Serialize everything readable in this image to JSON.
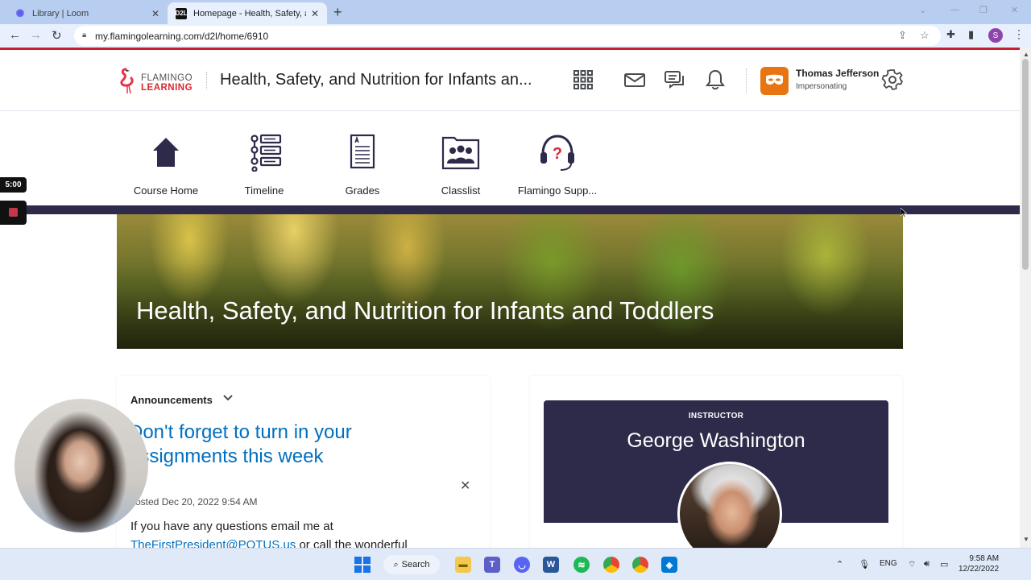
{
  "browser": {
    "tabs": [
      {
        "title": "Library | Loom",
        "active": false,
        "favicon": "loom-icon"
      },
      {
        "title": "Homepage - Health, Safety, and Nutrition for Infants and Toddlers",
        "active": true,
        "favicon": "d2l-icon"
      }
    ],
    "favicon_text": "D2L",
    "url": "my.flamingolearning.com/d2l/home/6910",
    "profile_initial": "S"
  },
  "header": {
    "logo_line1": "FLAMINGO",
    "logo_line2": "LEARNING",
    "course_title": "Health, Safety, and Nutrition for Infants an...",
    "icons": [
      "waffle-grid-icon",
      "mail-icon",
      "chat-icon",
      "bell-icon",
      "gear-icon"
    ],
    "user": {
      "name": "Thomas Jefferson",
      "role": "Impersonating"
    },
    "accent": "#e87511"
  },
  "nav": {
    "items": [
      {
        "label": "Course Home",
        "icon": "house-icon"
      },
      {
        "label": "Timeline",
        "icon": "timeline-icon"
      },
      {
        "label": "Grades",
        "icon": "grades-icon"
      },
      {
        "label": "Classlist",
        "icon": "classlist-icon"
      },
      {
        "label": "Flamingo Supp...",
        "icon": "support-headset-icon"
      }
    ],
    "band_color": "#2d2a4a"
  },
  "banner": {
    "title": "Health, Safety, and Nutrition for Infants and Toddlers"
  },
  "announcements": {
    "header": "Announcements",
    "item": {
      "title": "Don't forget to turn in your assignments this week",
      "posted": "Posted Dec 20, 2022 9:54 AM",
      "body_prefix": "If you have any questions email me at",
      "email": "TheFirstPresident@POTUS.us",
      "body_suffix": "or call the wonderful"
    }
  },
  "instructor": {
    "label": "INSTRUCTOR",
    "name": "George Washington"
  },
  "recorder": {
    "timer": "5:00"
  },
  "taskbar": {
    "search_label": "Search",
    "language": "ENG",
    "time": "9:58 AM",
    "date": "12/22/2022"
  }
}
